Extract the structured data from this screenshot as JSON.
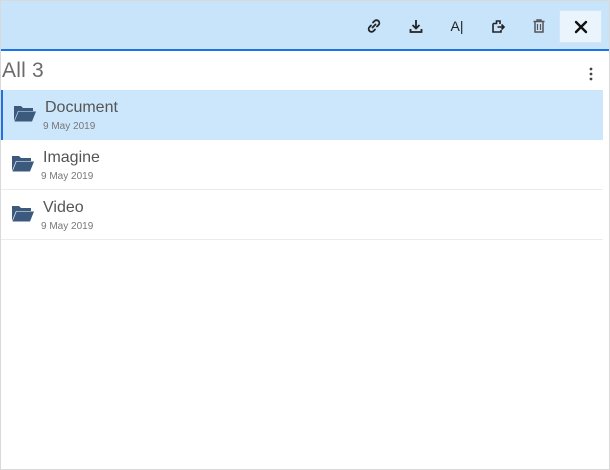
{
  "toolbar": {
    "actions": [
      {
        "icon": "link-icon"
      },
      {
        "icon": "download-icon"
      },
      {
        "icon": "rename-icon",
        "label": "A|"
      },
      {
        "icon": "move-icon"
      },
      {
        "icon": "trash-icon"
      },
      {
        "icon": "close-icon"
      }
    ]
  },
  "section": {
    "title": "All",
    "count": "3"
  },
  "items": [
    {
      "name": "Document",
      "date": "9 May 2019",
      "selected": true,
      "icon": "folder-icon"
    },
    {
      "name": "Imagine",
      "date": "9 May 2019",
      "selected": false,
      "icon": "folder-icon"
    },
    {
      "name": "Video",
      "date": "9 May 2019",
      "selected": false,
      "icon": "folder-icon"
    }
  ],
  "colors": {
    "toolbar_bg": "#c8e4fb",
    "accent": "#1a73e8",
    "selected_row": "#cce6fb",
    "folder": "#3c5a7d"
  }
}
